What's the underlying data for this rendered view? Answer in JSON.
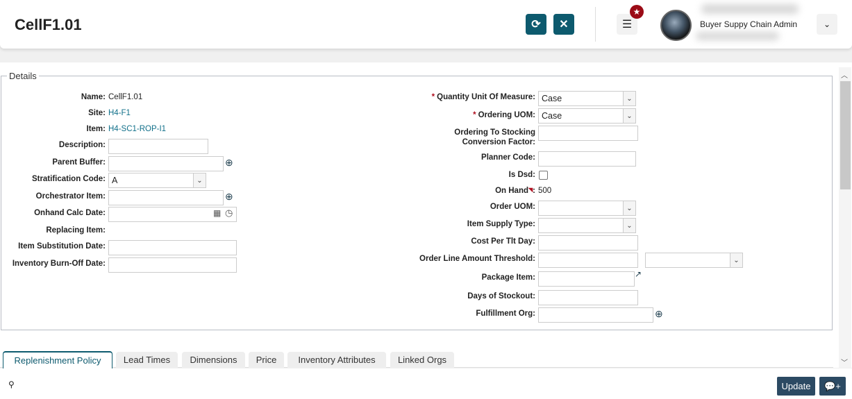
{
  "header": {
    "title": "CellF1.01",
    "user_name": "Buyer Suppy Chain Admin",
    "refresh_icon": "refresh-icon",
    "close_icon": "close-icon",
    "menu_icon": "hamburger-icon",
    "star_icon": "star-icon"
  },
  "details": {
    "legend": "Details",
    "left": {
      "name_label": "Name:",
      "name_value": "CellF1.01",
      "site_label": "Site:",
      "site_value": "H4-F1",
      "item_label": "Item:",
      "item_value": "H4-SC1-ROP-I1",
      "description_label": "Description:",
      "description_value": "",
      "parent_buffer_label": "Parent Buffer:",
      "parent_buffer_value": "",
      "stratification_label": "Stratification Code:",
      "stratification_value": "A",
      "orchestrator_label": "Orchestrator Item:",
      "orchestrator_value": "",
      "onhand_calc_label": "Onhand Calc Date:",
      "onhand_calc_value": "",
      "replacing_label": "Replacing Item:",
      "item_sub_label": "Item Substitution Date:",
      "item_sub_value": "",
      "burn_off_label": "Inventory Burn-Off Date:",
      "burn_off_value": ""
    },
    "right": {
      "qty_uom_label": "Quantity Unit Of Measure:",
      "qty_uom_value": "Case",
      "ordering_uom_label": "Ordering UOM:",
      "ordering_uom_value": "Case",
      "conv_label_1": "Ordering To Stocking",
      "conv_label_2": "Conversion Factor:",
      "planner_label": "Planner Code:",
      "is_dsd_label": "Is Dsd:",
      "is_dsd_checked": false,
      "on_hand_label": "On Hand",
      "on_hand_value": "500",
      "order_uom_label": "Order UOM:",
      "supply_type_label": "Item Supply Type:",
      "cost_label": "Cost Per Tlt Day:",
      "threshold_label": "Order Line Amount Threshold:",
      "package_label": "Package Item:",
      "days_label": "Days of Stockout:",
      "fulfillment_label": "Fulfillment Org:"
    }
  },
  "tabs": [
    "Replenishment Policy",
    "Lead Times",
    "Dimensions",
    "Price",
    "Inventory Attributes",
    "Linked Orgs"
  ],
  "footer": {
    "update_label": "Update"
  }
}
